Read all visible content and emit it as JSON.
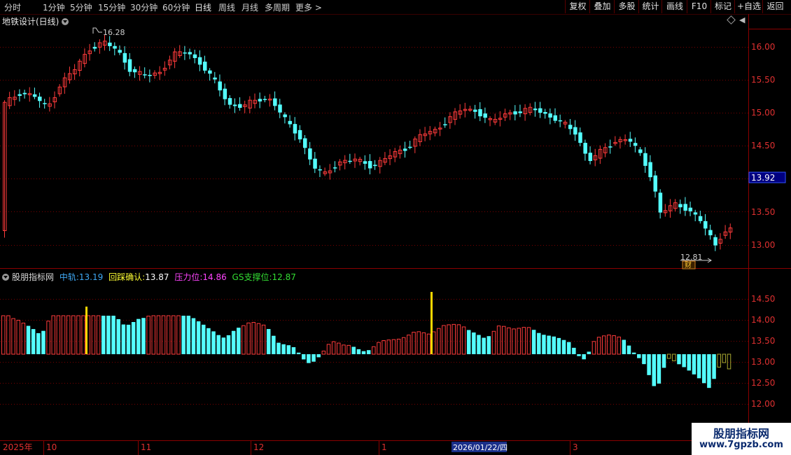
{
  "toolbar": {
    "periods": [
      "分时",
      "1分钟",
      "5分钟",
      "15分钟",
      "30分钟",
      "60分钟",
      "日线",
      "周线",
      "月线",
      "多周期",
      "更多"
    ],
    "right_buttons": [
      "复权",
      "叠加",
      "多股",
      "统计",
      "画线",
      "F10",
      "标记",
      "+自选",
      "返回"
    ]
  },
  "main_chart": {
    "title": "地铁设计(日线)",
    "price_axis": [
      "16.00",
      "15.50",
      "15.00",
      "14.50",
      "13.50",
      "13.00"
    ],
    "current_price": "13.92",
    "high_label": "16.28",
    "low_label": "12.81",
    "event_badge": "财"
  },
  "indicator": {
    "name": "股朋指标网",
    "fields": [
      {
        "label": "中轨:",
        "value": "13.19",
        "color": "#3fa9f5"
      },
      {
        "label": "回踩确认:",
        "value": "13.87",
        "color": "#ffff33"
      },
      {
        "label": "压力位:",
        "value": "14.86",
        "color": "#ff44ff"
      },
      {
        "label": "GS支撑位:",
        "value": "12.87",
        "color": "#33dd33"
      }
    ],
    "axis": [
      "14.50",
      "14.00",
      "13.50",
      "13.00",
      "12.50",
      "12.00"
    ]
  },
  "time_axis": {
    "labels": [
      "2025年",
      "10",
      "11",
      "12",
      "1",
      "2026/01/22/四",
      "3"
    ]
  },
  "watermark": {
    "line1": "股朋指标网",
    "line2": "www.7gpzb.com"
  },
  "colors": {
    "up": "#ff3b3b",
    "down": "#54ffff",
    "axis": "#8b0000",
    "grid": "#7a0000",
    "olive": "#a8a830",
    "highlight": "#ffd700"
  }
}
